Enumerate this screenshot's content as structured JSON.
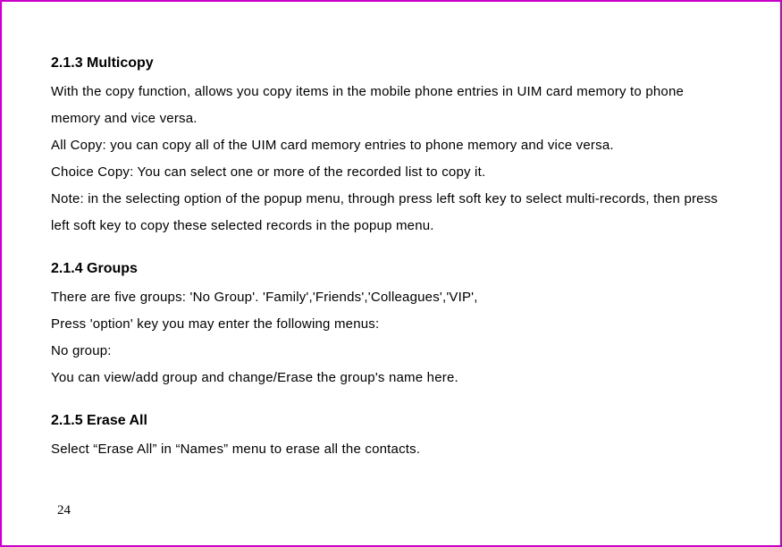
{
  "sections": [
    {
      "heading": "2.1.3 Multicopy",
      "paragraphs": [
        "With the copy function, allows you copy items in the mobile phone entries in UIM card memory to phone memory and vice versa.",
        "All Copy: you can copy all of the UIM card memory entries to phone memory and vice versa.",
        "Choice Copy: You can select one or more of the recorded list to copy it.",
        "Note: in the selecting option of the popup menu, through press left soft key to select multi-records, then press left soft key to copy these selected records in the popup menu."
      ]
    },
    {
      "heading": "2.1.4 Groups",
      "paragraphs": [
        "There are five groups: 'No Group'. 'Family','Friends','Colleagues','VIP',",
        "Press 'option' key you may enter the following menus:",
        "No group:",
        "You can view/add group and change/Erase the group's name here."
      ]
    },
    {
      "heading": "2.1.5 Erase All",
      "paragraphs": [
        "Select “Erase All” in “Names” menu to erase all the contacts."
      ]
    }
  ],
  "pageNumber": "24"
}
